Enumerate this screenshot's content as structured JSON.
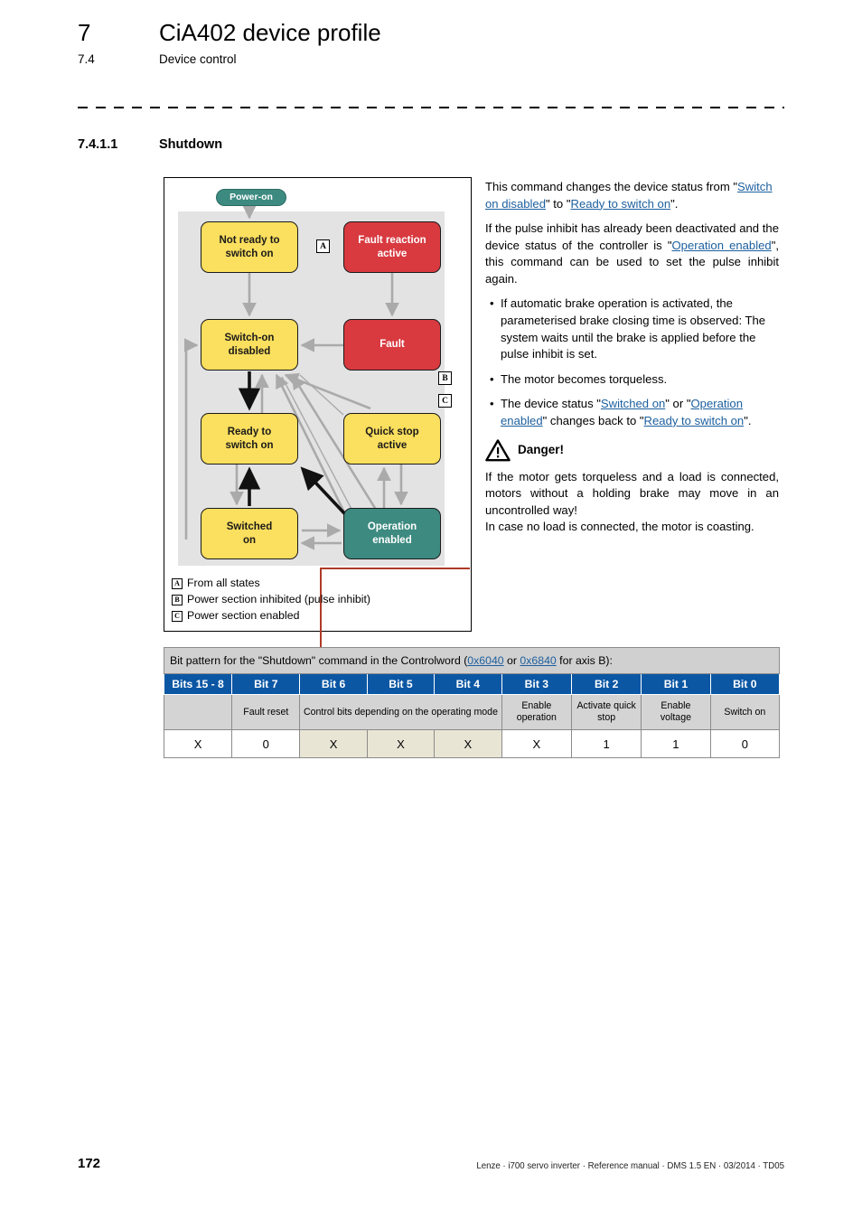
{
  "header": {
    "chapter_number": "7",
    "chapter_title": "CiA402 device profile",
    "section_number": "7.4",
    "section_title": "Device control",
    "subsection_number": "7.4.1.1",
    "subsection_title": "Shutdown"
  },
  "figure": {
    "nodes": {
      "power_on": "Power-on",
      "not_ready_to_switch_on": "Not ready to\nswitch on",
      "fault_reaction_active": "Fault reaction\nactive",
      "switch_on_disabled": "Switch-on\ndisabled",
      "fault": "Fault",
      "ready_to_switch_on": "Ready to\nswitch on",
      "quick_stop_active": "Quick stop\nactive",
      "switched_on": "Switched\non",
      "operation_enabled": "Operation\nenabled"
    },
    "markers": {
      "a": "A",
      "b": "B",
      "c": "C"
    },
    "legend": [
      {
        "key": "A",
        "text": "From all states"
      },
      {
        "key": "B",
        "text": "Power section inhibited (pulse inhibit)"
      },
      {
        "key": "C",
        "text": "Power section enabled"
      }
    ],
    "colors": {
      "yellow_state": "#fbdf5e",
      "red_state": "#d83a40",
      "teal_state": "#3d8a80",
      "panel_gray": "#e3e3e3",
      "zone_border_red": "#b03a27"
    }
  },
  "body": {
    "para1_a": "This command changes the device status from \"",
    "para1_link1": "Switch on disabled",
    "para1_b": "\" to \"",
    "para1_link2": "Ready to switch on",
    "para1_c": "\".",
    "para2_a": "If the pulse inhibit has already been deactivated and the device status of the controller is \"",
    "para2_link": "Operation enabled",
    "para2_b": "\", this command can be used to set the pulse inhibit again.",
    "bullet1": "If automatic brake operation is activated, the parameterised brake closing time is observed: The system waits until the brake is applied before the pulse inhibit is set.",
    "bullet2": "The motor becomes torqueless.",
    "bullet3_a": "The device status \"",
    "bullet3_link1": "Switched on",
    "bullet3_b": "\" or \"",
    "bullet3_link2": "Operation enabled",
    "bullet3_c": "\" changes back to \"",
    "bullet3_link3": "Ready to switch on",
    "bullet3_d": "\".",
    "danger_label": "Danger!",
    "danger_text1": "If the motor gets torqueless and a load is connected, motors without a holding brake may move in an uncontrolled way!",
    "danger_text2": "In case no load is connected, the motor is coasting."
  },
  "table": {
    "caption_a": "Bit pattern for the \"Shutdown\" command in the Controlword (",
    "caption_link1": "0x6040",
    "caption_b": " or ",
    "caption_link2": "0x6840",
    "caption_c": " for axis B):",
    "headers": [
      "Bits 15 - 8",
      "Bit 7",
      "Bit 6",
      "Bit 5",
      "Bit 4",
      "Bit 3",
      "Bit 2",
      "Bit 1",
      "Bit 0"
    ],
    "descriptions": {
      "bits15_8": "",
      "bit7": "Fault reset",
      "bits6_4": "Control bits depending on the operating mode",
      "bit3": "Enable operation",
      "bit2": "Activate quick stop",
      "bit1": "Enable voltage",
      "bit0": "Switch on"
    },
    "values": [
      "X",
      "0",
      "X",
      "X",
      "X",
      "X",
      "1",
      "1",
      "0"
    ],
    "header_color": "#0b57a4",
    "link_color": "#1c5f9e"
  },
  "footer": {
    "page_number": "172",
    "text": "Lenze · i700 servo inverter · Reference manual · DMS 1.5 EN · 03/2014 · TD05"
  }
}
